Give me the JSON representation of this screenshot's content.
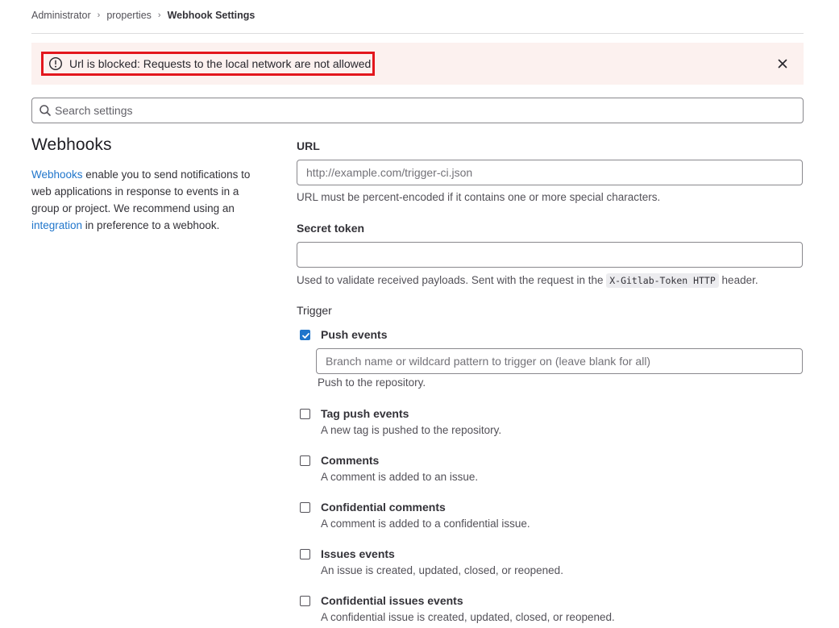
{
  "breadcrumb": {
    "items": [
      "Administrator",
      "properties",
      "Webhook Settings"
    ]
  },
  "alert": {
    "icon": "error-circle-icon",
    "message": "Url is blocked: Requests to the local network are not allowed"
  },
  "search": {
    "placeholder": "Search settings"
  },
  "section": {
    "title": "Webhooks",
    "desc_link1": "Webhooks",
    "desc_text1": " enable you to send notifications to web applications in response to events in a group or project. We recommend using an ",
    "desc_link2": "integration",
    "desc_text2": " in preference to a webhook."
  },
  "form": {
    "url_label": "URL",
    "url_placeholder": "http://example.com/trigger-ci.json",
    "url_value": "",
    "url_help": "URL must be percent-encoded if it contains one or more special characters.",
    "token_label": "Secret token",
    "token_value": "",
    "token_help_before": "Used to validate received payloads. Sent with the request in the ",
    "token_help_code": "X-Gitlab-Token HTTP",
    "token_help_after": " header.",
    "trigger_label": "Trigger",
    "branch_placeholder": "Branch name or wildcard pattern to trigger on (leave blank for all)"
  },
  "triggers": [
    {
      "title": "Push events",
      "desc": "Push to the repository.",
      "checked": true
    },
    {
      "title": "Tag push events",
      "desc": "A new tag is pushed to the repository.",
      "checked": false
    },
    {
      "title": "Comments",
      "desc": "A comment is added to an issue.",
      "checked": false
    },
    {
      "title": "Confidential comments",
      "desc": "A comment is added to a confidential issue.",
      "checked": false
    },
    {
      "title": "Issues events",
      "desc": "An issue is created, updated, closed, or reopened.",
      "checked": false
    },
    {
      "title": "Confidential issues events",
      "desc": "A confidential issue is created, updated, closed, or reopened.",
      "checked": false
    }
  ],
  "colors": {
    "link": "#1f75cb",
    "checkbox_checked": "#1f75cb",
    "alert_bg": "#fcf1ef",
    "alert_highlight": "#e3161d"
  }
}
